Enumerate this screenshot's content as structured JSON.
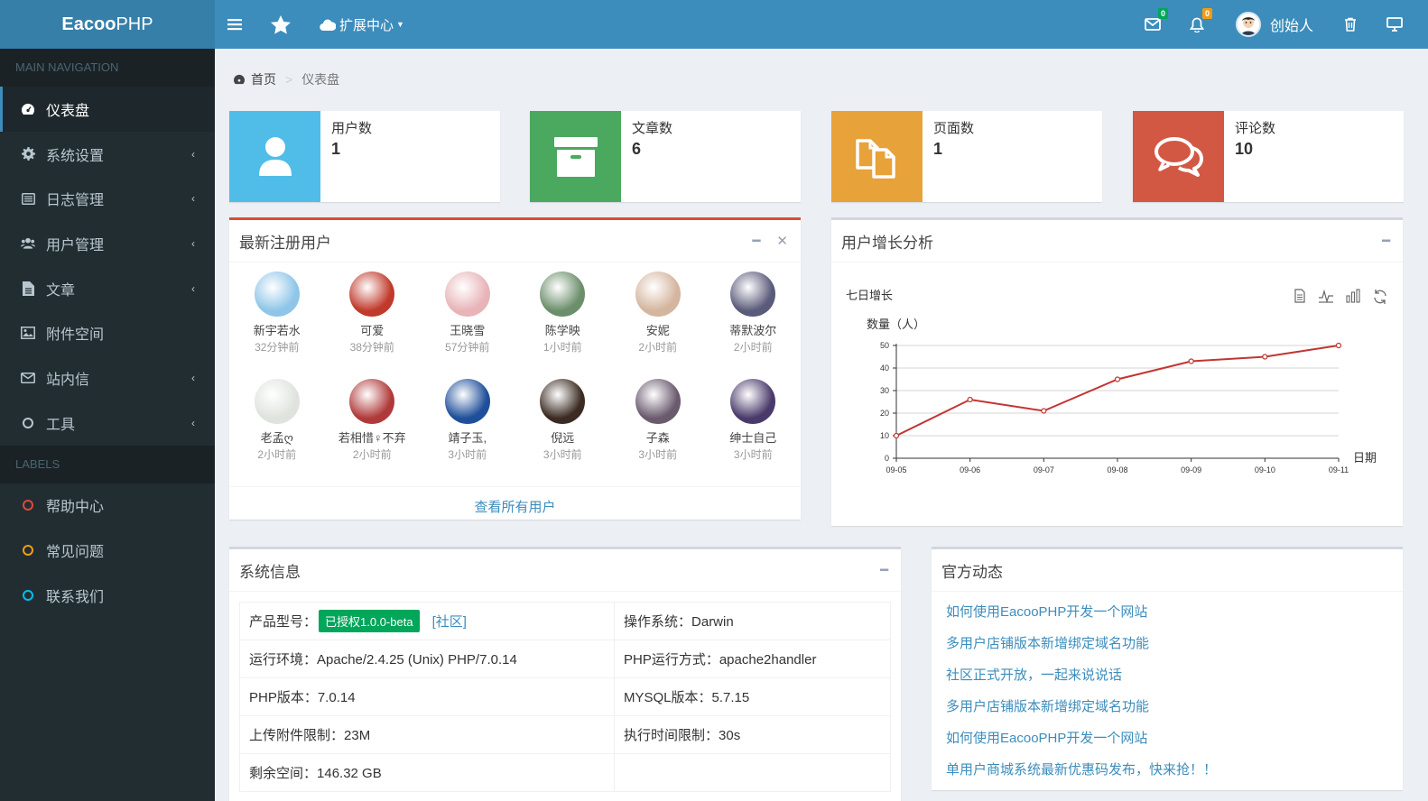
{
  "brand": {
    "bold": "Eacoo",
    "rest": "PHP"
  },
  "topbar": {
    "ext_center": "扩展中心",
    "mail_count": "0",
    "bell_count": "0",
    "user_name": "创始人"
  },
  "sidebar": {
    "main_header": "MAIN NAVIGATION",
    "items": [
      {
        "label": "仪表盘",
        "icon": "dashboard-icon"
      },
      {
        "label": "系统设置",
        "icon": "gear-icon"
      },
      {
        "label": "日志管理",
        "icon": "list-icon"
      },
      {
        "label": "用户管理",
        "icon": "users-icon"
      },
      {
        "label": "文章",
        "icon": "file-icon"
      },
      {
        "label": "附件空间",
        "icon": "image-icon"
      },
      {
        "label": "站内信",
        "icon": "envelope-icon"
      },
      {
        "label": "工具",
        "icon": "circle-icon"
      }
    ],
    "labels_header": "LABELS",
    "labels": [
      {
        "label": "帮助中心",
        "color": "#dd4b39"
      },
      {
        "label": "常见问题",
        "color": "#f39c12"
      },
      {
        "label": "联系我们",
        "color": "#00c0ef"
      }
    ]
  },
  "breadcrumb": {
    "home": "首页",
    "current": "仪表盘"
  },
  "stats": [
    {
      "label": "用户数",
      "value": "1",
      "color": "#00c0ef",
      "icon": "user-icon"
    },
    {
      "label": "文章数",
      "value": "6",
      "color": "#00a65a",
      "icon": "archive-icon"
    },
    {
      "label": "页面数",
      "value": "1",
      "color": "#f39c12",
      "icon": "copy-icon"
    },
    {
      "label": "评论数",
      "value": "10",
      "color": "#dd4b39",
      "icon": "comments-icon"
    }
  ],
  "latest_users": {
    "title": "最新注册用户",
    "users": [
      {
        "name": "新宇若水",
        "time": "32分钟前",
        "color": "#8ec5e8"
      },
      {
        "name": "可爱",
        "time": "38分钟前",
        "color": "#c0392b"
      },
      {
        "name": "王晓雪",
        "time": "57分钟前",
        "color": "#e8b4b8"
      },
      {
        "name": "陈学映",
        "time": "1小时前",
        "color": "#6b8e6b"
      },
      {
        "name": "安妮",
        "time": "2小时前",
        "color": "#d4b59e"
      },
      {
        "name": "蒂默波尔",
        "time": "2小时前",
        "color": "#5a5a7a"
      },
      {
        "name": "老孟ღ",
        "time": "2小时前",
        "color": "#dfe3dd"
      },
      {
        "name": "若相惜♀不弃",
        "time": "2小时前",
        "color": "#b03a3a"
      },
      {
        "name": "靖子玉,",
        "time": "3小时前",
        "color": "#1f4f9a"
      },
      {
        "name": "倪远",
        "time": "3小时前",
        "color": "#3b2b22"
      },
      {
        "name": "子森",
        "time": "3小时前",
        "color": "#6a5a6e"
      },
      {
        "name": "绅士自己",
        "time": "3小时前",
        "color": "#4a3a6a"
      }
    ],
    "footer": "查看所有用户"
  },
  "growth": {
    "title": "用户增长分析",
    "chart_title": "七日增长"
  },
  "chart_data": {
    "type": "line",
    "title": "七日增长",
    "ylabel": "数量（人）",
    "xlabel": "日期",
    "categories": [
      "09-05",
      "09-06",
      "09-07",
      "09-08",
      "09-09",
      "09-10",
      "09-11"
    ],
    "series": [
      {
        "values": [
          10,
          26,
          21,
          35,
          43,
          45,
          50
        ]
      }
    ],
    "ylim": [
      0,
      50
    ],
    "yticks": [
      0,
      10,
      20,
      30,
      40,
      50
    ],
    "grid": true,
    "line_color": "#c23531"
  },
  "sysinfo": {
    "title": "系统信息",
    "product_label": "产品型号：",
    "license": "已授权1.0.0-beta",
    "community": "[社区]",
    "os_label": "操作系统：",
    "os": "Darwin",
    "env_label": "运行环境：",
    "env": "Apache/2.4.25 (Unix) PHP/7.0.14",
    "php_mode_label": "PHP运行方式：",
    "php_mode": "apache2handler",
    "php_ver_label": "PHP版本：",
    "php_ver": "7.0.14",
    "mysql_label": "MYSQL版本：",
    "mysql": "5.7.15",
    "upload_label": "上传附件限制：",
    "upload": "23M",
    "exec_label": "执行时间限制：",
    "exec": "30s",
    "space_label": "剩余空间：",
    "space": "146.32 GB"
  },
  "news": {
    "title": "官方动态",
    "items": [
      "如何使用EacooPHP开发一个网站",
      "多用户店铺版本新增绑定域名功能",
      "社区正式开放，一起来说说话",
      "多用户店铺版本新增绑定域名功能",
      "如何使用EacooPHP开发一个网站",
      "单用户商城系统最新优惠码发布，快来抢！！"
    ]
  }
}
